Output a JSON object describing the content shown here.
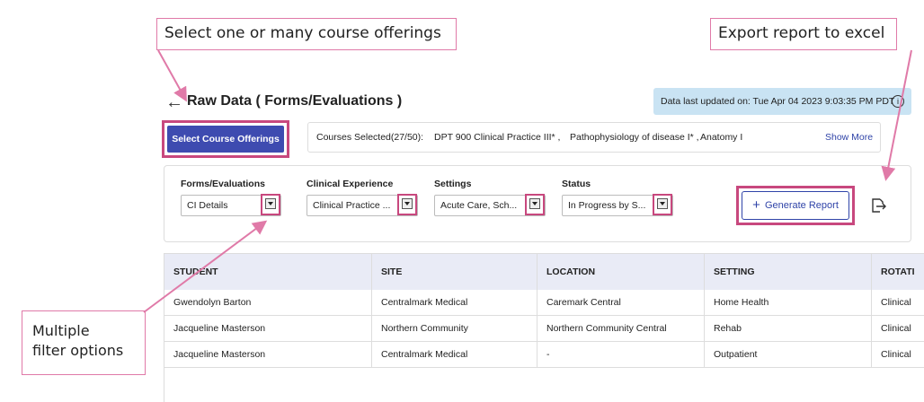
{
  "annotations": {
    "select_courses": "Select one or many course offerings",
    "export_report": "Export report to excel",
    "filter_options_line1": "Multiple",
    "filter_options_line2": "filter options"
  },
  "header": {
    "back_icon": "arrow-left-icon",
    "title": "Raw Data  ( Forms/Evaluations )",
    "last_updated": "Data last updated on: Tue Apr 04 2023 9:03:35 PM PDT",
    "info_icon": "info-icon"
  },
  "courses": {
    "select_button": "Select Course Offerings",
    "selected_label": "Courses Selected(27/50):",
    "items": [
      "DPT 900 Clinical Practice III* ,",
      "Pathophysiology of disease I* ,",
      "Anatomy I"
    ],
    "show_more": "Show More"
  },
  "filters": [
    {
      "label": "Forms/Evaluations",
      "value": "CI Details"
    },
    {
      "label": "Clinical Experience",
      "value": "Clinical Practice ..."
    },
    {
      "label": "Settings",
      "value": "Acute Care, Sch..."
    },
    {
      "label": "Status",
      "value": "In Progress by S..."
    }
  ],
  "generate_button": "Generate Report",
  "export_icon": "export-icon",
  "table": {
    "columns": [
      "STUDENT",
      "SITE",
      "LOCATION",
      "SETTING",
      "ROTATI"
    ],
    "rows": [
      [
        "Gwendolyn Barton",
        "Centralmark Medical",
        "Caremark Central",
        "Home Health",
        "Clinical"
      ],
      [
        "Jacqueline Masterson",
        "Northern Community",
        "Northern Community Central",
        "Rehab",
        "Clinical"
      ],
      [
        "Jacqueline Masterson",
        "Centralmark Medical",
        "-",
        "Outpatient",
        "Clinical"
      ]
    ]
  },
  "colors": {
    "primary": "#3e4bb0",
    "highlight": "#c8487e",
    "banner": "#c9e3f3",
    "table_header": "#e9ebf6"
  }
}
